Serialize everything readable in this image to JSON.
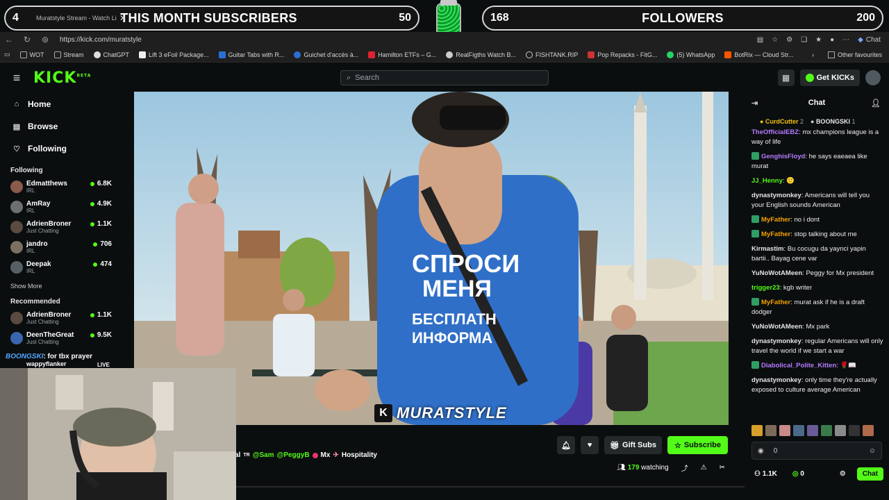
{
  "goals": {
    "left": {
      "current": "4",
      "title": "THIS MONTH SUBSCRIBERS",
      "target": "50"
    },
    "right": {
      "current": "168",
      "title": "FOLLOWERS",
      "target": "200"
    }
  },
  "browser": {
    "tab_title": "Muratstyle Stream - Watch Li",
    "url": "https://kick.com/muratstyle",
    "chat_label": "Chat",
    "bookmarks": [
      "WOT",
      "Stream",
      "ChatGPT",
      "Lift 3 eFoil Package...",
      "Guitar Tabs with R...",
      "Guichet d'accès à...",
      "Hamilton ETFs – G...",
      "RealFigths Watch B...",
      "FISHTANK.RIP",
      "Pop Repacks - FitG...",
      "(5) WhatsApp",
      "BotRix — Cloud Str..."
    ],
    "other_favourites": "Other favourites"
  },
  "kick": {
    "logo": "KICK",
    "logo_tag": "BETA",
    "search_placeholder": "Search",
    "get_kicks": "Get KICKs"
  },
  "sidebar": {
    "nav": [
      {
        "label": "Home",
        "icon": "home-icon"
      },
      {
        "label": "Browse",
        "icon": "browse-icon"
      },
      {
        "label": "Following",
        "icon": "heart-icon"
      }
    ],
    "following_title": "Following",
    "following": [
      {
        "name": "Edmatthews",
        "sub": "IRL",
        "count": "6.8K"
      },
      {
        "name": "AmRay",
        "sub": "IRL",
        "count": "4.9K"
      },
      {
        "name": "AdrienBroner",
        "sub": "Just Chatting",
        "count": "1.1K"
      },
      {
        "name": "jandro",
        "sub": "IRL",
        "count": "706"
      },
      {
        "name": "Deepak",
        "sub": "IRL",
        "count": "474"
      }
    ],
    "show_more": "Show More",
    "recommended_title": "Recommended",
    "recommended": [
      {
        "name": "AdrienBroner",
        "sub": "Just Chatting",
        "count": "1.1K"
      },
      {
        "name": "DeenTheGreat",
        "sub": "Just Chatting",
        "count": "9.5K"
      }
    ],
    "overlay_user": "BOONGSKI",
    "overlay_text": ": for tbx prayer",
    "overlay_next": "wappyflanker",
    "overlay_live": "LIVE"
  },
  "video": {
    "watermark": "MURATSTYLE"
  },
  "stream_info": {
    "title_prefix": "al ",
    "flag": "TR",
    "mention1": "@Sam",
    "mention2": "@PeggyB",
    "mid": "Mx",
    "tail": "Hospitality",
    "gift_subs": "Gift Subs",
    "subscribe": "Subscribe",
    "watching_count": "179",
    "watching_label": "watching"
  },
  "chat": {
    "title": "Chat",
    "pinned": [
      {
        "name": "CurdCutter",
        "count": "2"
      },
      {
        "name": "BOONGSKI",
        "count": "1"
      }
    ],
    "messages": [
      {
        "user": "TheOfficialEBZ",
        "color": "#b57bff",
        "text": ": mx champions league is a way of life",
        "badge": false
      },
      {
        "user": "GenghisFloyd",
        "color": "#b57bff",
        "text": ": he says eaeaea like murat",
        "badge": true
      },
      {
        "user": "JJ_Henny",
        "color": "#53fc18",
        "text": ": 🙂",
        "badge": false
      },
      {
        "user": "dynastymonkey",
        "color": "#e6e6e6",
        "text": ": Americans will tell you your English sounds American",
        "badge": false
      },
      {
        "user": "MyFather",
        "color": "#f4a000",
        "text": ": no i dont",
        "badge": true
      },
      {
        "user": "MyFather",
        "color": "#f4a000",
        "text": ": stop talking about me",
        "badge": true
      },
      {
        "user": "Kirmastim",
        "color": "#e6e6e6",
        "text": ": Bu cocugu da yaynci yapin bartii.. Bayag cene var",
        "badge": false
      },
      {
        "user": "YuNoWotAMeen",
        "color": "#e6e6e6",
        "text": ": Peggy for Mx president",
        "badge": false
      },
      {
        "user": "trigger23",
        "color": "#53fc18",
        "text": ": kgb writer",
        "badge": false
      },
      {
        "user": "MyFather",
        "color": "#f4a000",
        "text": ": murat ask if he is a draft dodger",
        "badge": true
      },
      {
        "user": "YuNoWotAMeen",
        "color": "#e6e6e6",
        "text": ": Mx park",
        "badge": false
      },
      {
        "user": "dynastymonkey",
        "color": "#e6e6e6",
        "text": ": regular Americans will only travel the world if we start a war",
        "badge": false
      },
      {
        "user": "Diabolical_Polite_Kitten",
        "color": "#b57bff",
        "text": ": 🌹📖",
        "badge": true
      },
      {
        "user": "dynastymonkey",
        "color": "#e6e6e6",
        "text": ": only time they're actually exposed to culture average American",
        "badge": false
      }
    ],
    "input_value": "0",
    "followers_count": "1.1K",
    "kicks_count": "0",
    "chat_button": "Chat"
  }
}
